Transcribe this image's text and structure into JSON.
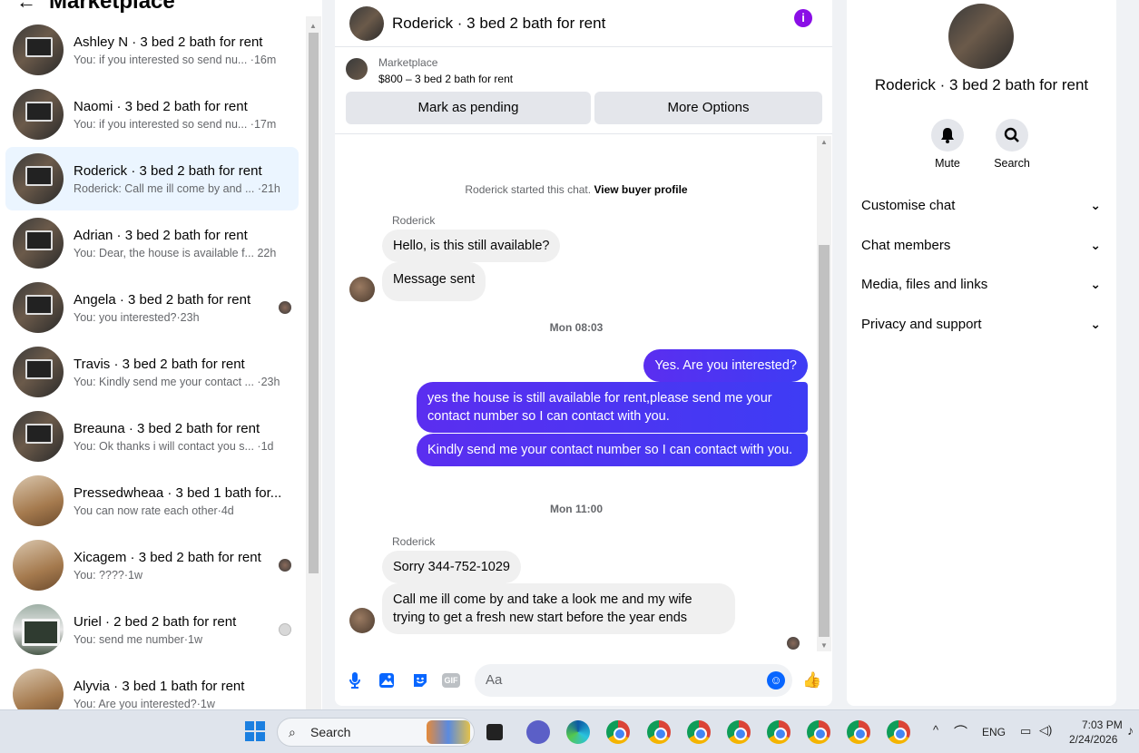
{
  "left": {
    "title": "Marketplace",
    "back_icon": "←",
    "conversations": [
      {
        "name": "Ashley N · 3 bed 2 bath for rent",
        "preview": "You: if you interested so send nu... ·16m"
      },
      {
        "name": "Naomi · 3 bed 2 bath for rent",
        "preview": "You: if you interested so send nu... ·17m"
      },
      {
        "name": "Roderick · 3 bed 2 bath for rent",
        "preview": "Roderick: Call me ill come by and ... ·21h"
      },
      {
        "name": "Adrian · 3 bed 2 bath for rent",
        "preview": "You: Dear, the house is available f... 22h"
      },
      {
        "name": "Angela · 3 bed 2 bath for rent",
        "preview": "You: you interested?·23h"
      },
      {
        "name": "Travis · 3 bed 2 bath for rent",
        "preview": "You: Kindly send me your contact ... ·23h"
      },
      {
        "name": "Breauna · 3 bed 2 bath for rent",
        "preview": "You: Ok thanks i will contact you s... ·1d"
      },
      {
        "name": "Pressedwheaa · 3 bed 1 bath for...",
        "preview": "You can now rate each other·4d"
      },
      {
        "name": "Xicagem · 3 bed 2 bath for rent",
        "preview": "You: ????·1w"
      },
      {
        "name": "Uriel · 2 bed 2 bath for rent",
        "preview": "You: send me number·1w"
      },
      {
        "name": "Alyvia · 3 bed 1 bath for rent",
        "preview": "You: Are you interested?·1w"
      }
    ]
  },
  "chat": {
    "title": "Roderick · 3 bed 2 bath for rent",
    "info_icon": "i",
    "marketplace_label": "Marketplace",
    "listing": "$800 – 3 bed 2 bath for rent",
    "mark_pending": "Mark as pending",
    "more_options": "More Options",
    "started": "Roderick started this chat.",
    "view_profile": "View buyer profile",
    "sender": "Roderick",
    "msg1": "Hello, is this still available?",
    "msg2": "Message sent",
    "time1": "Mon 08:03",
    "out1": "Yes. Are you interested?",
    "out2": "yes the house is still available for rent,please send me your contact number so I can contact with you.",
    "out3": "Kindly send me your contact number so I can contact with you.",
    "time2": "Mon 11:00",
    "msg3": "Sorry 344-752-1029",
    "msg4": "Call me ill come by and take a look me and my wife trying to get a fresh new start before the year ends",
    "composer_placeholder": "Aa",
    "gif_label": "GIF",
    "like_icon": "👍"
  },
  "right": {
    "title": "Roderick · 3 bed 2 bath for rent",
    "mute": "Mute",
    "search": "Search",
    "sections": [
      "Customise chat",
      "Chat members",
      "Media, files and links",
      "Privacy and support"
    ]
  },
  "taskbar": {
    "search": "Search",
    "lang": "ENG",
    "time": "7:03 PM",
    "date": "2/24/2026"
  }
}
